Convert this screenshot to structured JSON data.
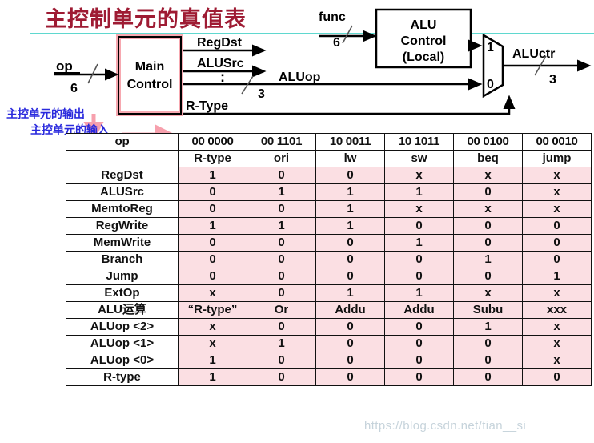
{
  "title": "主控制单元的真值表",
  "annotations": {
    "output_note": "主控单元的输出",
    "input_note": "主控单元的输入"
  },
  "diagram": {
    "main_control_label_line1": "Main",
    "main_control_label_line2": "Control",
    "alu_control_line1": "ALU",
    "alu_control_line2": "Control",
    "alu_control_line3": "(Local)",
    "op_label": "op",
    "op_width": "6",
    "func_label": "func",
    "func_width": "6",
    "signal_regdst": "RegDst",
    "signal_alusrc": "ALUSrc",
    "signal_colon": ":",
    "signal_aluop": "ALUop",
    "aluop_width": "3",
    "signal_rtype": "R-Type",
    "mux_top_label": "1",
    "mux_bottom_label": "0",
    "aluctr_label": "ALUctr",
    "aluctr_width": "3"
  },
  "table": {
    "op_header": "op",
    "opcodes": [
      "00 0000",
      "00 1101",
      "10 0011",
      "10 1011",
      "00 0100",
      "00 0010"
    ],
    "instructions": [
      "R-type",
      "ori",
      "lw",
      "sw",
      "beq",
      "jump"
    ],
    "rows": [
      {
        "label": "RegDst",
        "style": "plain",
        "values": [
          "1",
          "0",
          "0",
          "x",
          "x",
          "x"
        ]
      },
      {
        "label": "ALUSrc",
        "style": "plain",
        "values": [
          "0",
          "1",
          "1",
          "1",
          "0",
          "x"
        ]
      },
      {
        "label": "MemtoReg",
        "style": "plain",
        "values": [
          "0",
          "0",
          "1",
          "x",
          "x",
          "x"
        ]
      },
      {
        "label": "RegWrite",
        "style": "plain",
        "values": [
          "1",
          "1",
          "1",
          "0",
          "0",
          "0"
        ]
      },
      {
        "label": "MemWrite",
        "style": "plain",
        "values": [
          "0",
          "0",
          "0",
          "1",
          "0",
          "0"
        ]
      },
      {
        "label": "Branch",
        "style": "plain",
        "values": [
          "0",
          "0",
          "0",
          "0",
          "1",
          "0"
        ]
      },
      {
        "label": "Jump",
        "style": "plain",
        "values": [
          "0",
          "0",
          "0",
          "0",
          "0",
          "1"
        ]
      },
      {
        "label": "ExtOp",
        "style": "plain",
        "values": [
          "x",
          "0",
          "1",
          "1",
          "x",
          "x"
        ]
      },
      {
        "label": "ALU运算",
        "style": "alu",
        "values": [
          "“R-type”",
          "Or",
          "Addu",
          "Addu",
          "Subu",
          "xxx"
        ]
      },
      {
        "label": "ALUop <2>",
        "style": "aluop",
        "values": [
          "x",
          "0",
          "0",
          "0",
          "1",
          "x"
        ]
      },
      {
        "label": "ALUop <1>",
        "style": "aluop",
        "values": [
          "x",
          "1",
          "0",
          "0",
          "0",
          "x"
        ]
      },
      {
        "label": "ALUop <0>",
        "style": "aluop",
        "values": [
          "1",
          "0",
          "0",
          "0",
          "0",
          "x"
        ]
      },
      {
        "label": "R-type",
        "style": "plain",
        "values": [
          "1",
          "0",
          "0",
          "0",
          "0",
          "0"
        ]
      }
    ]
  },
  "watermark": "https://blog.csdn.net/tian__si",
  "colors": {
    "title": "#9e1b33",
    "rule": "#5fd8cf",
    "annotation": "#2b2bdd",
    "highlight_box": "#f7a8b0",
    "cell_fill": "#fbdfe3",
    "aluop_label": "#a50b32"
  }
}
